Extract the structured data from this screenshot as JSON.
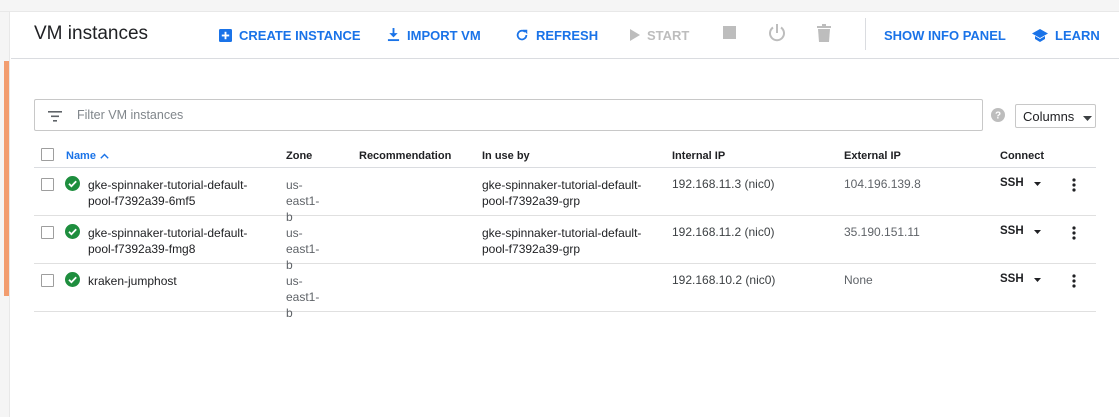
{
  "header": {
    "title": "VM instances",
    "actions": {
      "create": "CREATE INSTANCE",
      "import": "IMPORT VM",
      "refresh": "REFRESH",
      "start": "START",
      "info_panel": "SHOW INFO PANEL",
      "learn": "LEARN"
    }
  },
  "filter": {
    "placeholder": "Filter VM instances"
  },
  "columns_button": "Columns",
  "table": {
    "headers": {
      "name": "Name",
      "zone": "Zone",
      "recommendation": "Recommendation",
      "in_use_by": "In use by",
      "internal_ip": "Internal IP",
      "external_ip": "External IP",
      "connect": "Connect"
    },
    "rows": [
      {
        "name_line1": "gke-spinnaker-tutorial-default-",
        "name_line2": "pool-f7392a39-6mf5",
        "zone_line1": "us-",
        "zone_line2": "east1-b",
        "recommendation": "",
        "in_use_line1": "gke-spinnaker-tutorial-default-",
        "in_use_line2": "pool-f7392a39-grp",
        "internal_ip": "192.168.11.3 (nic0)",
        "external_ip": "104.196.139.8",
        "connect": "SSH"
      },
      {
        "name_line1": "gke-spinnaker-tutorial-default-",
        "name_line2": "pool-f7392a39-fmg8",
        "zone_line1": "us-",
        "zone_line2": "east1-b",
        "recommendation": "",
        "in_use_line1": "gke-spinnaker-tutorial-default-",
        "in_use_line2": "pool-f7392a39-grp",
        "internal_ip": "192.168.11.2 (nic0)",
        "external_ip": "35.190.151.11",
        "connect": "SSH"
      },
      {
        "name_line1": "kraken-jumphost",
        "name_line2": "",
        "zone_line1": "us-",
        "zone_line2": "east1-b",
        "recommendation": "",
        "in_use_line1": "",
        "in_use_line2": "",
        "internal_ip": "192.168.10.2 (nic0)",
        "external_ip": "None",
        "connect": "SSH"
      }
    ]
  },
  "icons": {
    "create": "add-box-icon",
    "import": "download-icon",
    "refresh": "refresh-icon",
    "start": "play-icon",
    "stop": "stop-icon",
    "reset": "power-icon",
    "delete": "trash-icon",
    "learn": "school-icon",
    "filter": "filter-list-icon",
    "help": "help-icon",
    "status": "check-circle-icon",
    "more": "more-vert-icon"
  },
  "colors": {
    "accent": "#1a73e8",
    "status_ok": "#1e8e3e",
    "side_indicator": "#f29d6f",
    "disabled": "#bdbdbd"
  }
}
